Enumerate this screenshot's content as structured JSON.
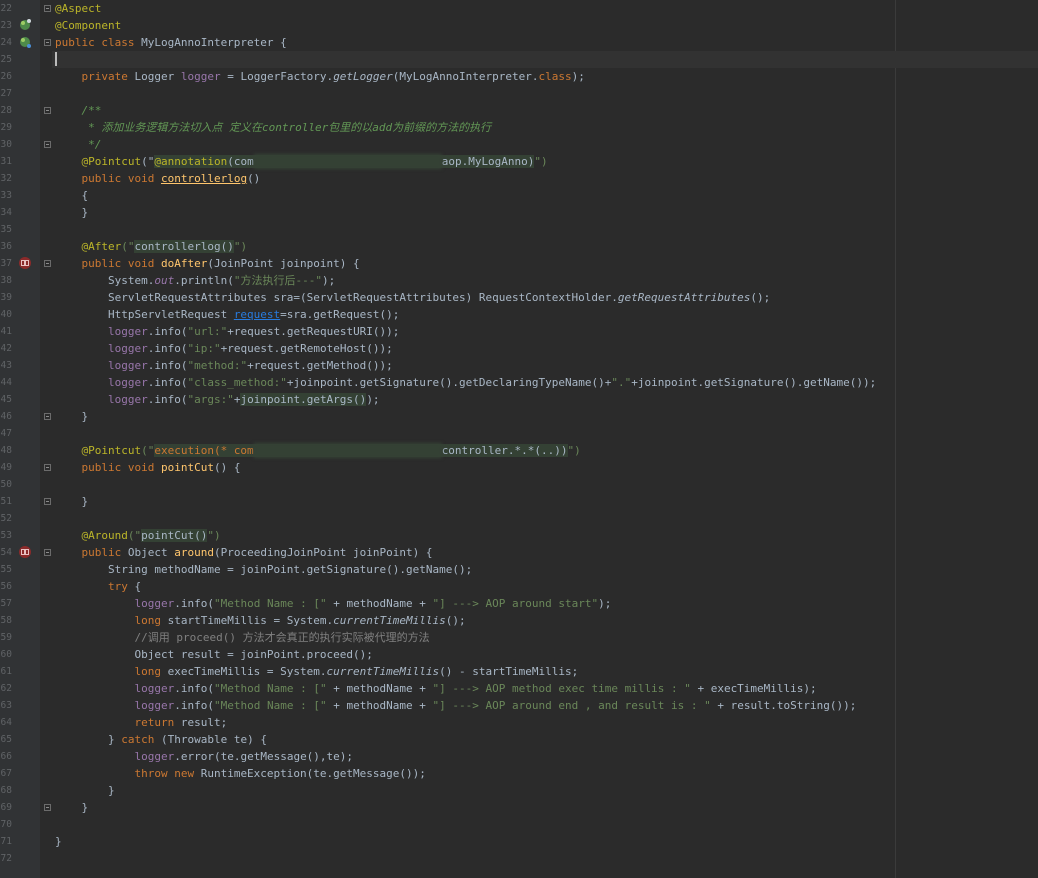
{
  "editor": {
    "file_class": "MyLogAnnoInterpreter",
    "line_numbers": [
      "22",
      "23",
      "24",
      "25",
      "26",
      "27",
      "28",
      "29",
      "30",
      "31",
      "32",
      "33",
      "34",
      "35",
      "36",
      "37",
      "38",
      "39",
      "40",
      "41",
      "42",
      "43",
      "44",
      "45",
      "46",
      "47",
      "48",
      "49",
      "50",
      "51",
      "52",
      "53",
      "54",
      "55",
      "56",
      "57",
      "58",
      "59",
      "60",
      "61",
      "62",
      "63",
      "64",
      "65",
      "66",
      "67",
      "68",
      "69",
      "70",
      "71",
      "72"
    ],
    "gutter_icons": [
      {
        "line": 23,
        "icon": "bean-icon"
      },
      {
        "line": 24,
        "icon": "bean-icon"
      },
      {
        "line": 37,
        "icon": "aop-advice-icon"
      },
      {
        "line": 54,
        "icon": "aop-advice-icon"
      }
    ],
    "colors": {
      "background": "#2b2b2b",
      "keyword": "#cc7832",
      "annotation": "#bbb529",
      "string": "#6a8759",
      "field": "#9876aa",
      "method_decl": "#ffc66d",
      "doc_comment": "#629755",
      "line_comment": "#808080",
      "text": "#a9b7c6"
    },
    "lines": {
      "l22": "@Aspect",
      "l23": "@Component",
      "l24a": "public class ",
      "l24b": "MyLogAnnoInterpreter {",
      "l26a": "    private ",
      "l26b": "Logger ",
      "l26c": "logger",
      "l26d": " = LoggerFactory.",
      "l26e": "getLogger",
      "l26f": "(MyLogAnnoInterpreter.",
      "l26g": "class",
      "l26h": ");",
      "l28": "    /**",
      "l29": "     * 添加业务逻辑方法切入点 定义在controller包里的以add为前缀的方法的执行",
      "l30": "     */",
      "l31a": "    @Pointcut",
      "l31b": "(\"",
      "l31c": "@annotation",
      "l31d": "(com",
      "l31e": "aop.MyLogAnno)",
      "l31f": "\")",
      "l32a": "    public void ",
      "l32b": "controllerlog",
      "l32c": "()",
      "l33": "    {",
      "l34": "    }",
      "l36a": "    @After",
      "l36b": "(\"",
      "l36c": "controllerlog()",
      "l36d": "\")",
      "l37a": "    public void ",
      "l37b": "doAfter",
      "l37c": "(JoinPoint joinpoint) {",
      "l38a": "        System.",
      "l38b": "out",
      "l38c": ".println(",
      "l38d": "\"方法执行后---\"",
      "l38e": ");",
      "l39a": "        ServletRequestAttributes sra=(ServletRequestAttributes) RequestContextHolder.",
      "l39b": "getRequestAttributes",
      "l39c": "();",
      "l40a": "        HttpServletRequest ",
      "l40b": "request",
      "l40c": "=sra.getRequest();",
      "l41a": "        ",
      "l41b": "logger",
      "l41c": ".info(",
      "l41d": "\"url:\"",
      "l41e": "+request.getRequestURI());",
      "l42b": "logger",
      "l42c": ".info(",
      "l42d": "\"ip:\"",
      "l42e": "+request.getRemoteHost());",
      "l43b": "logger",
      "l43c": ".info(",
      "l43d": "\"method:\"",
      "l43e": "+request.getMethod());",
      "l44b": "logger",
      "l44c": ".info(",
      "l44d": "\"class_method:\"",
      "l44e": "+joinpoint.getSignature().getDeclaringTypeName()+",
      "l44f": "\".\"",
      "l44g": "+joinpoint.getSignature().getName());",
      "l45b": "logger",
      "l45c": ".info(",
      "l45d": "\"args:\"",
      "l45e": "+",
      "l45f": "joinpoint.getArgs()",
      "l45g": ");",
      "l46": "    }",
      "l48a": "    @Pointcut",
      "l48b": "(\"",
      "l48c": "execution(* com",
      "l48d": "controller.*.*(..))",
      "l48e": "\")",
      "l49a": "    public void ",
      "l49b": "pointCut",
      "l49c": "() {",
      "l51": "    }",
      "l53a": "    @Around",
      "l53b": "(\"",
      "l53c": "pointCut()",
      "l53d": "\")",
      "l54a": "    public ",
      "l54b": "Object ",
      "l54c": "around",
      "l54d": "(ProceedingJoinPoint joinPoint) {",
      "l55": "        String methodName = joinPoint.getSignature().getName();",
      "l56a": "        try",
      "l56b": " {",
      "l57a": "            ",
      "l57b": "logger",
      "l57c": ".info(",
      "l57d": "\"Method Name : [\"",
      "l57e": " + methodName + ",
      "l57f": "\"] ---> AOP around start\"",
      "l57g": ");",
      "l58a": "            long ",
      "l58b": "startTimeMillis = System.",
      "l58c": "currentTimeMillis",
      "l58d": "();",
      "l59": "            //调用 proceed() 方法才会真正的执行实际被代理的方法",
      "l60": "            Object result = joinPoint.proceed();",
      "l61a": "            long ",
      "l61b": "execTimeMillis = System.",
      "l61c": "currentTimeMillis",
      "l61d": "() - startTimeMillis;",
      "l62b": "logger",
      "l62c": ".info(",
      "l62d": "\"Method Name : [\"",
      "l62e": " + methodName + ",
      "l62f": "\"] ---> AOP method exec time millis : \"",
      "l62g": " + execTimeMillis);",
      "l63b": "logger",
      "l63c": ".info(",
      "l63d": "\"Method Name : [\"",
      "l63e": " + methodName + ",
      "l63f": "\"] ---> AOP around end , and result is : \"",
      "l63g": " + result.toString());",
      "l64a": "            return ",
      "l64b": "result;",
      "l65a": "        } ",
      "l65b": "catch",
      "l65c": " (Throwable te) {",
      "l66b": "logger",
      "l66c": ".error(te.getMessage(),te);",
      "l67a": "            throw new ",
      "l67b": "RuntimeException(te.getMessage());",
      "l68": "        }",
      "l69": "    }",
      "l71": "}"
    }
  }
}
